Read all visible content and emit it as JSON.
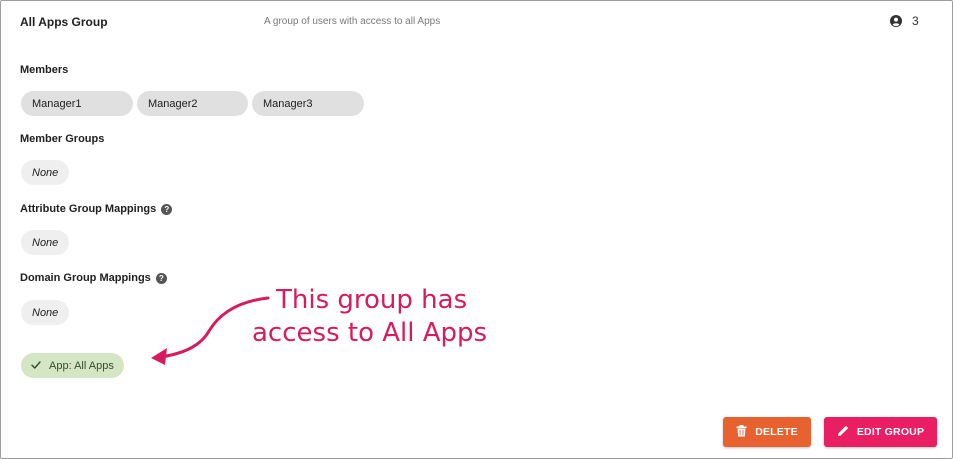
{
  "group": {
    "title": "All Apps Group",
    "description": "A group of users with access to all Apps",
    "member_count": "3"
  },
  "sections": {
    "members_label": "Members",
    "members": [
      "Manager1",
      "Manager2",
      "Manager3"
    ],
    "member_groups_label": "Member Groups",
    "member_groups_value": "None",
    "attribute_mappings_label": "Attribute Group Mappings",
    "attribute_mappings_value": "None",
    "domain_mappings_label": "Domain Group Mappings",
    "domain_mappings_value": "None",
    "app_access": "App: All Apps"
  },
  "annotation": {
    "line1": "This group has",
    "line2": "access to All Apps",
    "color": "#d81b60"
  },
  "actions": {
    "delete_label": "DELETE",
    "edit_label": "EDIT GROUP"
  },
  "icons": {
    "user_count": "user-icon",
    "help": "help-icon",
    "check": "check-icon",
    "delete": "trash-icon",
    "edit": "pencil-icon"
  },
  "colors": {
    "delete": "#e8622f",
    "edit": "#e91e63",
    "app_chip": "#d4e6c4"
  }
}
